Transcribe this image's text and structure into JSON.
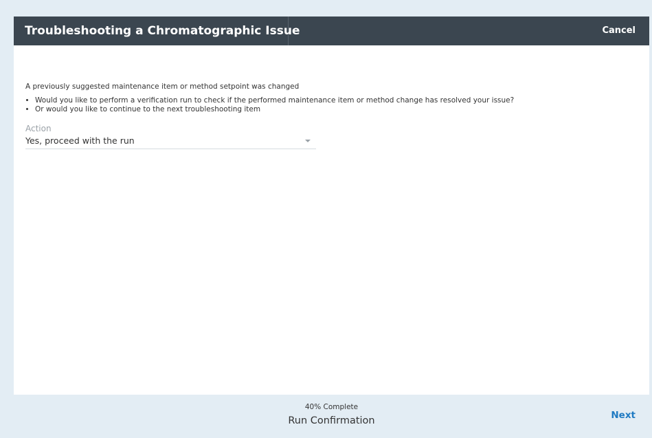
{
  "dialog": {
    "title": "Troubleshooting a Chromatographic Issue",
    "cancel_label": "Cancel"
  },
  "content": {
    "intro": "A previously suggested maintenance item or method setpoint was changed",
    "bullets": [
      "Would you like to perform a verification run to check if the performed maintenance item or method change has resolved your issue?",
      "Or would you like to continue to the next troubleshooting item"
    ],
    "action": {
      "label": "Action",
      "selected_value": "Yes, proceed with the run"
    }
  },
  "footer": {
    "progress_text": "40% Complete",
    "progress_percent": 40,
    "step_name": "Run Confirmation",
    "next_label": "Next"
  },
  "colors": {
    "header_bg": "#3b4650",
    "page_bg": "#e3edf4",
    "accent": "#1f7ac2"
  },
  "icons": {
    "select_caret": "chevron-down-icon"
  }
}
